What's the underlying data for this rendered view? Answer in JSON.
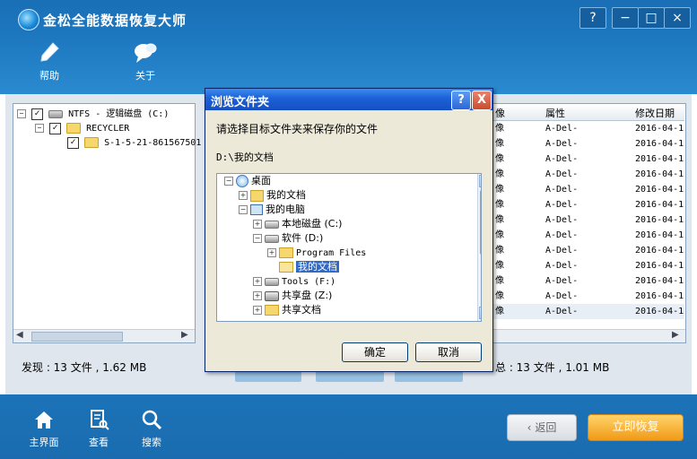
{
  "app": {
    "title": "金松全能数据恢复大师",
    "toolbar": [
      {
        "label": "帮助",
        "icon": "pen-icon"
      },
      {
        "label": "关于",
        "icon": "chat-bubble-icon"
      }
    ]
  },
  "left_tree": [
    {
      "label": "NTFS - 逻辑磁盘 (C:)",
      "checked": true,
      "expanded": true
    },
    {
      "label": "RECYCLER",
      "checked": true,
      "expanded": true
    },
    {
      "label": "S-1-5-21-861567501",
      "checked": true
    }
  ],
  "file_list": {
    "headers": {
      "type": "像",
      "attr": "属性",
      "date": "修改日期"
    },
    "rows": [
      {
        "type": "像",
        "attr": "A-Del-",
        "date": "2016-04-1"
      },
      {
        "type": "像",
        "attr": "A-Del-",
        "date": "2016-04-1"
      },
      {
        "type": "像",
        "attr": "A-Del-",
        "date": "2016-04-1"
      },
      {
        "type": "像",
        "attr": "A-Del-",
        "date": "2016-04-1"
      },
      {
        "type": "像",
        "attr": "A-Del-",
        "date": "2016-04-1"
      },
      {
        "type": "像",
        "attr": "A-Del-",
        "date": "2016-04-1"
      },
      {
        "type": "像",
        "attr": "A-Del-",
        "date": "2016-04-1"
      },
      {
        "type": "像",
        "attr": "A-Del-",
        "date": "2016-04-1"
      },
      {
        "type": "像",
        "attr": "A-Del-",
        "date": "2016-04-1"
      },
      {
        "type": "像",
        "attr": "A-Del-",
        "date": "2016-04-1"
      },
      {
        "type": "像",
        "attr": "A-Del-",
        "date": "2016-04-1"
      },
      {
        "type": "像",
        "attr": "A-Del-",
        "date": "2016-04-1"
      },
      {
        "type": "像",
        "attr": "A-Del-",
        "date": "2016-04-1"
      }
    ]
  },
  "status": {
    "found": "发现 : 13 文件 , 1.62 MB",
    "selected": "总 : 13 文件 , 1.01 MB"
  },
  "bottom_nav": [
    {
      "label": "主界面",
      "icon": "home-icon"
    },
    {
      "label": "查看",
      "icon": "document-search-icon"
    },
    {
      "label": "搜索",
      "icon": "magnifier-icon"
    }
  ],
  "actions": {
    "back": "返回",
    "recover": "立即恢复"
  },
  "dialog": {
    "title": "浏览文件夹",
    "help": "?",
    "close": "X",
    "prompt": "请选择目标文件夹来保存你的文件",
    "path": "D:\\我的文档",
    "tree": [
      {
        "label": "桌面",
        "level": 0,
        "expander": "−",
        "icon": "desktop-icon"
      },
      {
        "label": "我的文档",
        "level": 1,
        "expander": "+",
        "icon": "documents-icon"
      },
      {
        "label": "我的电脑",
        "level": 1,
        "expander": "−",
        "icon": "computer-icon"
      },
      {
        "label": "本地磁盘 (C:)",
        "level": 2,
        "expander": "+",
        "icon": "drive-icon"
      },
      {
        "label": "软件 (D:)",
        "level": 2,
        "expander": "−",
        "icon": "drive-icon"
      },
      {
        "label": "Program Files",
        "level": 3,
        "expander": "+",
        "icon": "folder-icon"
      },
      {
        "label": "我的文档",
        "level": 3,
        "expander": "",
        "icon": "folder-open-icon",
        "selected": true
      },
      {
        "label": "Tools (F:)",
        "level": 2,
        "expander": "+",
        "icon": "drive-icon"
      },
      {
        "label": "共享盘 (Z:)",
        "level": 2,
        "expander": "+",
        "icon": "network-drive-icon"
      },
      {
        "label": "共享文档",
        "level": 2,
        "expander": "+",
        "icon": "folder-icon"
      }
    ],
    "ok": "确定",
    "cancel": "取消"
  },
  "window_controls": {
    "help": "?",
    "minimize": "−",
    "maximize": "□",
    "close": "×"
  }
}
